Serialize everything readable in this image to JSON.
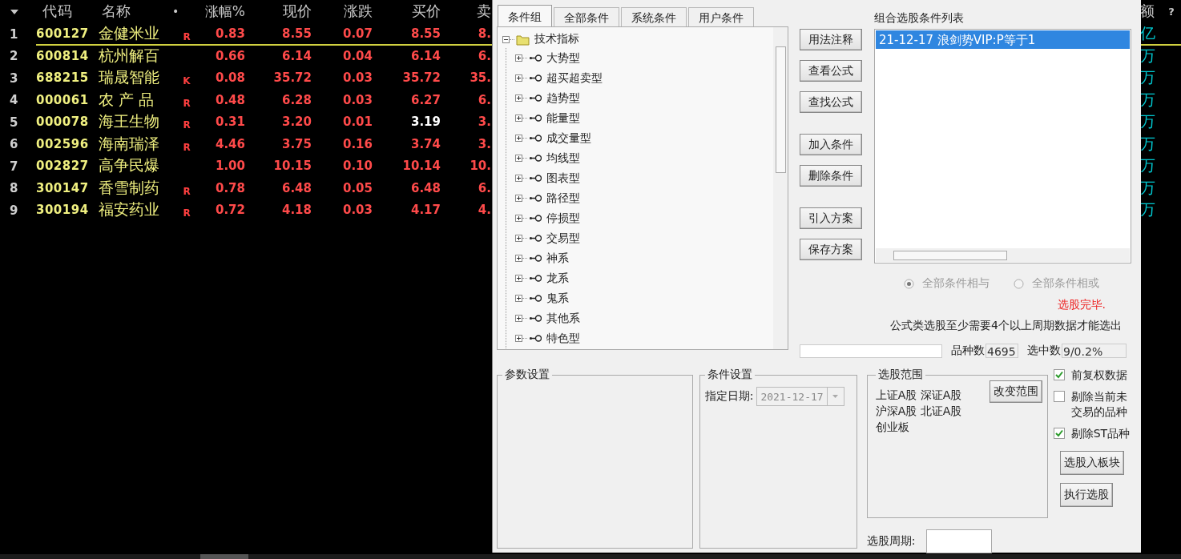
{
  "quote_table": {
    "headers": {
      "code": "代码",
      "name": "名称",
      "flag": "•",
      "change": "涨幅%",
      "price": "现价",
      "diff": "涨跌",
      "bid": "买价",
      "ask": "卖",
      "amount": "额",
      "help": "?"
    },
    "rows": [
      {
        "num": "1",
        "code": "600127",
        "name": "金健米业",
        "flag": "R",
        "change": "0.83",
        "price": "8.55",
        "diff": "0.07",
        "bid": {
          "text": "8.55",
          "color": "#ff4a4a"
        },
        "ask": "8.",
        "amount": "亿",
        "selected": true
      },
      {
        "num": "2",
        "code": "600814",
        "name": "杭州解百",
        "change": "0.66",
        "price": "6.14",
        "diff": "0.04",
        "bid": {
          "text": "6.14",
          "color": "#ff4a4a"
        },
        "ask": "6.",
        "amount": "万",
        "selected": false
      },
      {
        "num": "3",
        "code": "688215",
        "name": "瑞晟智能",
        "flag": "K",
        "change": "0.08",
        "price": "35.72",
        "diff": "0.03",
        "bid": {
          "text": "35.72",
          "color": "#ff4a4a"
        },
        "ask": "35.",
        "amount": "万",
        "selected": false
      },
      {
        "num": "4",
        "code": "000061",
        "name": "农 产 品",
        "flag": "R",
        "change": "0.48",
        "price": "6.28",
        "diff": "0.03",
        "bid": {
          "text": "6.27",
          "color": "#ff4a4a"
        },
        "ask": "6.",
        "amount": "万",
        "selected": false
      },
      {
        "num": "5",
        "code": "000078",
        "name": "海王生物",
        "flag": "R",
        "change": "0.31",
        "price": "3.20",
        "diff": "0.01",
        "bid": {
          "text": "3.19",
          "color": "#ffffff"
        },
        "ask": "3.",
        "amount": "万",
        "selected": false
      },
      {
        "num": "6",
        "code": "002596",
        "name": "海南瑞泽",
        "flag": "R",
        "change": "4.46",
        "price": "3.75",
        "diff": "0.16",
        "bid": {
          "text": "3.74",
          "color": "#ff4a4a"
        },
        "ask": "3.",
        "amount": "万",
        "selected": false
      },
      {
        "num": "7",
        "code": "002827",
        "name": "高争民爆",
        "change": "1.00",
        "price": "10.15",
        "diff": "0.10",
        "bid": {
          "text": "10.14",
          "color": "#ff4a4a"
        },
        "ask": "10.",
        "amount": "万",
        "selected": false
      },
      {
        "num": "8",
        "code": "300147",
        "name": "香雪制药",
        "flag": "R",
        "change": "0.78",
        "price": "6.48",
        "diff": "0.05",
        "bid": {
          "text": "6.48",
          "color": "#ff4a4a"
        },
        "ask": "6.",
        "amount": "万",
        "selected": false
      },
      {
        "num": "9",
        "code": "300194",
        "name": "福安药业",
        "flag": "R",
        "change": "0.72",
        "price": "4.18",
        "diff": "0.03",
        "bid": {
          "text": "4.17",
          "color": "#ff4a4a"
        },
        "ask": "4.",
        "amount": "万",
        "selected": false
      }
    ]
  },
  "dialog": {
    "tabs": [
      {
        "label": "条件组",
        "selected": true
      },
      {
        "label": "全部条件",
        "selected": false
      },
      {
        "label": "系统条件",
        "selected": false
      },
      {
        "label": "用户条件",
        "selected": false
      }
    ],
    "tree": {
      "label": "技术指标",
      "expanded": true,
      "children": [
        {
          "label": "大势型",
          "expanded": false
        },
        {
          "label": "超买超卖型",
          "expanded": false
        },
        {
          "label": "趋势型",
          "expanded": false
        },
        {
          "label": "能量型",
          "expanded": false
        },
        {
          "label": "成交量型",
          "expanded": false
        },
        {
          "label": "均线型",
          "expanded": false
        },
        {
          "label": "图表型",
          "expanded": false
        },
        {
          "label": "路径型",
          "expanded": false
        },
        {
          "label": "停损型",
          "expanded": false
        },
        {
          "label": "交易型",
          "expanded": false
        },
        {
          "label": "神系",
          "expanded": false
        },
        {
          "label": "龙系",
          "expanded": false
        },
        {
          "label": "鬼系",
          "expanded": false
        },
        {
          "label": "其他系",
          "expanded": false
        },
        {
          "label": "特色型",
          "expanded": false
        }
      ]
    },
    "side_buttons": [
      "用法注释",
      "查看公式",
      "查找公式",
      "加入条件",
      "删除条件",
      "引入方案",
      "保存方案"
    ],
    "condition_list": {
      "title": "组合选股条件列表",
      "items": [
        {
          "label": "21-12-17 浪剑势VIP:P等于1",
          "selected": true
        }
      ]
    },
    "logic": {
      "disabled": true,
      "options": [
        {
          "label": "全部条件相与",
          "selected": true
        },
        {
          "label": "全部条件相或",
          "selected": false
        }
      ]
    },
    "status": "选股完毕.",
    "note": "公式类选股至少需要4个以上周期数据才能选出",
    "stock_count": {
      "label": "品种数",
      "value": "4695"
    },
    "selected_count": {
      "label": "选中数",
      "value": "9/0.2%"
    },
    "param_group": {
      "title": "参数设置"
    },
    "condition_group": {
      "title": "条件设置",
      "date_label": "指定日期:",
      "date_value": "2021-12-17",
      "disabled": true
    },
    "range_group": {
      "title": "选股范围",
      "lines": [
        "上证A股 深证A股",
        "沪深A股 北证A股",
        "创业板"
      ],
      "button": "改变范围"
    },
    "options": [
      {
        "label": "前复权数据",
        "checked": true
      },
      {
        "label": "剔除当前未交易的品种",
        "checked": false
      },
      {
        "label": "剔除ST品种",
        "checked": true
      }
    ],
    "action_buttons": [
      "选股入板块",
      "执行选股"
    ],
    "period": {
      "label": "选股周期:"
    }
  }
}
